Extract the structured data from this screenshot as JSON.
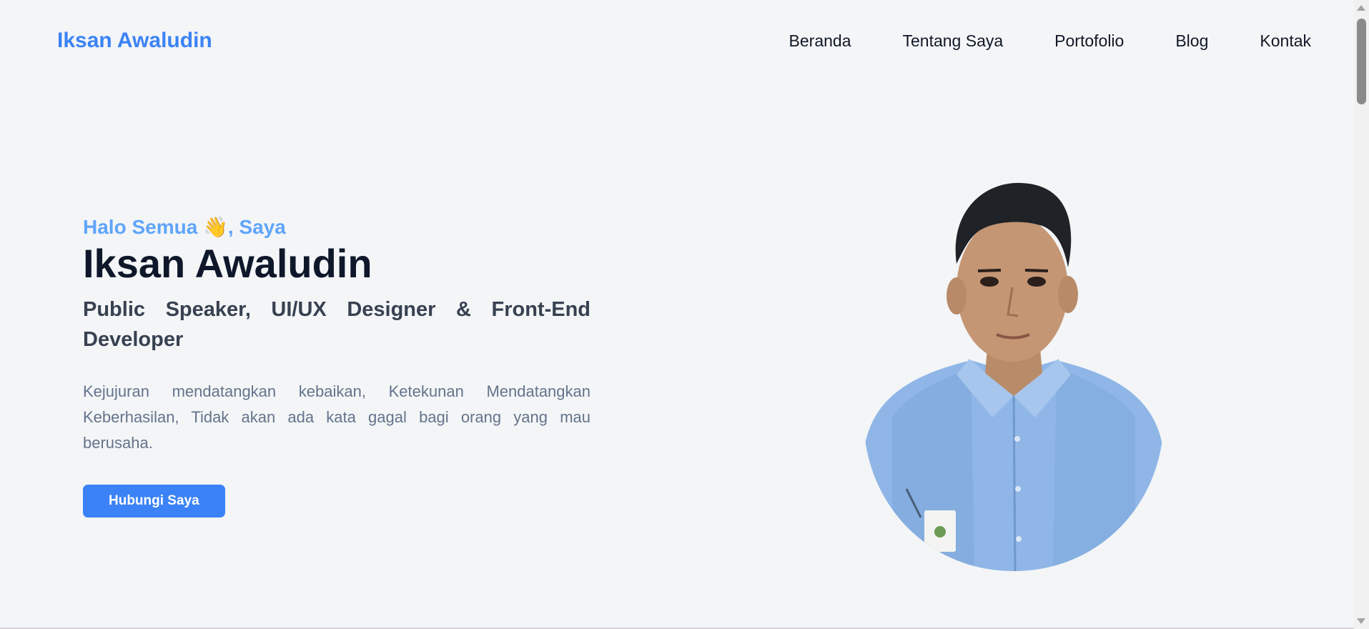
{
  "header": {
    "brand": "Iksan Awaludin",
    "nav": [
      {
        "label": "Beranda"
      },
      {
        "label": "Tentang Saya"
      },
      {
        "label": "Portofolio"
      },
      {
        "label": "Blog"
      },
      {
        "label": "Kontak"
      }
    ]
  },
  "hero": {
    "greeting": "Halo Semua 👋, Saya",
    "name": "Iksan Awaludin",
    "role": "Public Speaker, UI/UX Designer & Front-End Developer",
    "description": "Kejujuran mendatangkan kebaikan, Ketekunan Mendatangkan Keberhasilan, Tidak akan ada kata gagal bagi orang yang mau berusaha.",
    "cta_label": "Hubungi Saya"
  },
  "photo": {
    "icon": "profile-photo"
  },
  "colors": {
    "accent": "#3b82f6",
    "greeting": "#60a5fa",
    "background": "#f3f5f7",
    "heading": "#0f172a",
    "shirt": "#8fb6e6"
  }
}
